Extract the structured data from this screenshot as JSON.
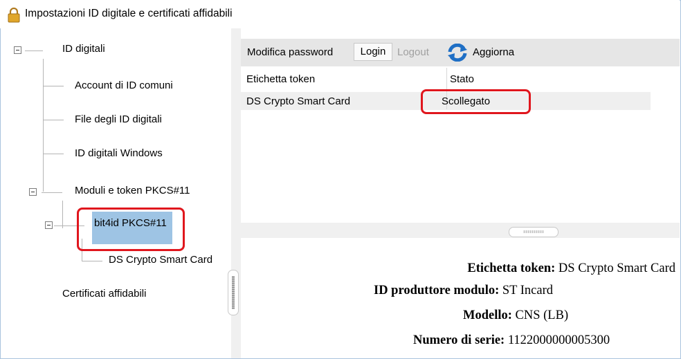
{
  "window": {
    "title": "Impostazioni ID digitale e certificati affidabili",
    "icon": "lock-icon"
  },
  "tree": {
    "root_label": "ID digitali",
    "items": [
      "Account di ID comuni",
      "File degli ID digitali",
      "ID digitali Windows",
      "Moduli e token PKCS#11"
    ],
    "module_label": "bit4id PKCS#11",
    "token_label": "DS Crypto Smart Card",
    "trusted_label": "Certificati affidabili"
  },
  "toolbar": {
    "change_password": "Modifica password",
    "login": "Login",
    "logout": "Logout",
    "refresh": "Aggiorna"
  },
  "table": {
    "headers": [
      "Etichetta token",
      "Stato"
    ],
    "rows": [
      {
        "label": "DS Crypto Smart Card",
        "status": "Scollegato"
      }
    ]
  },
  "details": [
    {
      "key": "Etichetta token:",
      "value": "DS Crypto Smart Card"
    },
    {
      "key": "ID produttore modulo:",
      "value": "ST Incard"
    },
    {
      "key": "Modello:",
      "value": "CNS (LB)"
    },
    {
      "key": "Numero di serie:",
      "value": "1122000000005300"
    }
  ],
  "colors": {
    "highlight": "#e0161d",
    "selection": "#9ec4e4",
    "refresh_icon": "#1f6fc5"
  }
}
